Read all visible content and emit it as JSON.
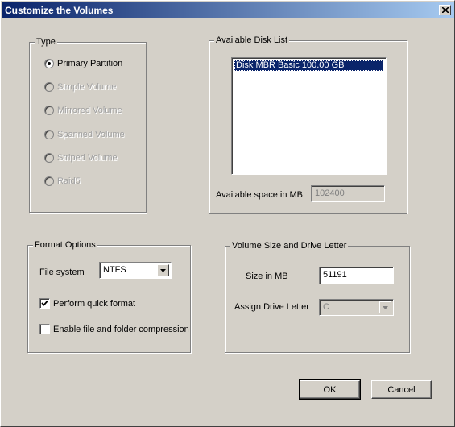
{
  "window": {
    "title": "Customize the Volumes"
  },
  "type_group": {
    "legend": "Type",
    "options": [
      {
        "label": "Primary Partition",
        "selected": true,
        "enabled": true
      },
      {
        "label": "Simple Volume",
        "selected": false,
        "enabled": false
      },
      {
        "label": "Mirrored Volume",
        "selected": false,
        "enabled": false
      },
      {
        "label": "Spanned Volume",
        "selected": false,
        "enabled": false
      },
      {
        "label": "Striped Volume",
        "selected": false,
        "enabled": false
      },
      {
        "label": "Raid5",
        "selected": false,
        "enabled": false
      }
    ]
  },
  "disk_group": {
    "legend": "Available Disk List",
    "disks": [
      "Disk  MBR Basic 100.00 GB"
    ],
    "space_label": "Available space in MB",
    "space_value": "102400"
  },
  "format_group": {
    "legend": "Format Options",
    "filesystem_label": "File system",
    "filesystem_value": "NTFS",
    "quick_format_label": "Perform quick format",
    "quick_format_checked": true,
    "compression_label": "Enable file and folder compression",
    "compression_checked": false
  },
  "volume_group": {
    "legend": "Volume Size and Drive Letter",
    "size_label": "Size in MB",
    "size_value": "51191",
    "drive_label": "Assign Drive Letter",
    "drive_value": "C"
  },
  "buttons": {
    "ok": "OK",
    "cancel": "Cancel"
  },
  "colors": {
    "titlebar_start": "#0a246a",
    "titlebar_end": "#a6caf0",
    "face": "#d4d0c8",
    "selection": "#0a246a"
  }
}
